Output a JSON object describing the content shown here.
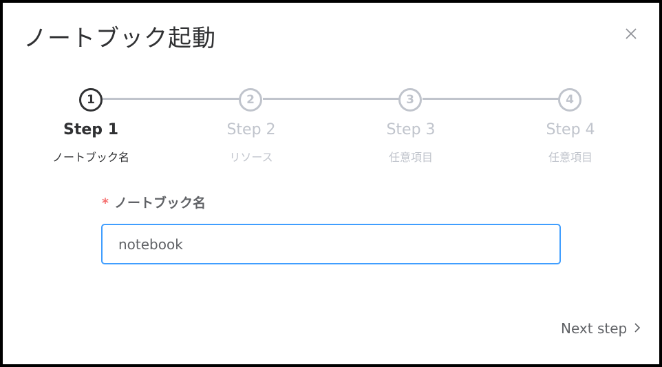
{
  "dialog": {
    "title": "ノートブック起動"
  },
  "steps": [
    {
      "number": "1",
      "title": "Step 1",
      "description": "ノートブック名",
      "active": true
    },
    {
      "number": "2",
      "title": "Step 2",
      "description": "リソース",
      "active": false
    },
    {
      "number": "3",
      "title": "Step 3",
      "description": "任意項目",
      "active": false
    },
    {
      "number": "4",
      "title": "Step 4",
      "description": "任意項目",
      "active": false
    }
  ],
  "form": {
    "required_mark": "*",
    "label": "ノートブック名",
    "value": "notebook"
  },
  "footer": {
    "next_label": "Next step"
  },
  "colors": {
    "active": "#303133",
    "inactive": "#c0c4cc",
    "focus_border": "#409eff",
    "required": "#f56c6c"
  }
}
